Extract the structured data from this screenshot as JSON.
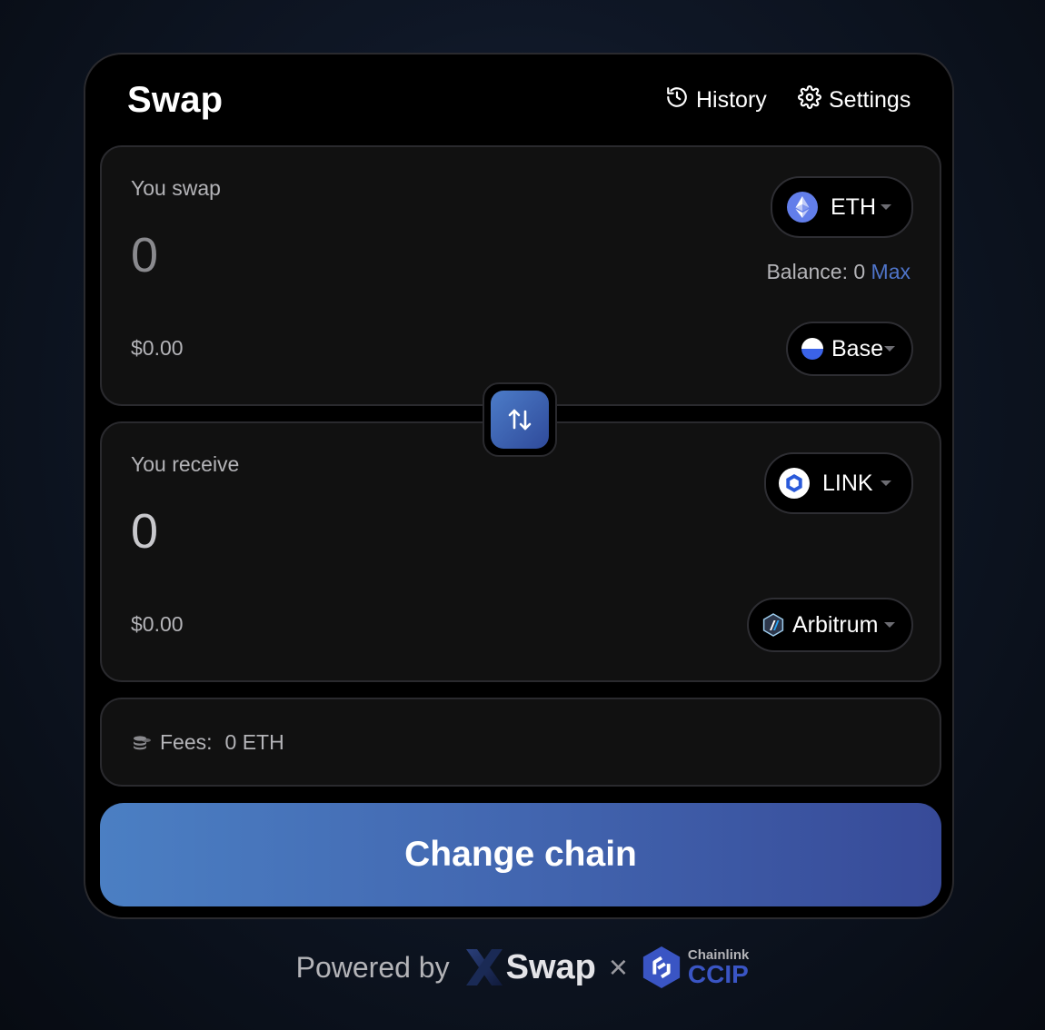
{
  "header": {
    "title": "Swap",
    "history_label": "History",
    "settings_label": "Settings"
  },
  "from": {
    "label": "You swap",
    "amount": "0",
    "usd": "$0.00",
    "token": "ETH",
    "balance_label": "Balance: 0",
    "max_label": "Max",
    "chain": "Base"
  },
  "to": {
    "label": "You receive",
    "amount": "0",
    "usd": "$0.00",
    "token": "LINK",
    "chain": "Arbitrum"
  },
  "fees": {
    "label": "Fees:",
    "value": "0 ETH"
  },
  "cta": {
    "label": "Change chain"
  },
  "footer": {
    "powered_by": "Powered by",
    "brand1": "Swap",
    "times": "×",
    "brand2_top": "Chainlink",
    "brand2_bottom": "CCIP"
  },
  "colors": {
    "accent": "#4f74c9",
    "cta_start": "#4b7fc3",
    "cta_end": "#374a98"
  },
  "icons": [
    "history-icon",
    "settings-icon",
    "eth-icon",
    "base-icon",
    "link-icon",
    "arbitrum-icon",
    "swap-direction-icon",
    "coins-icon",
    "xswap-logo",
    "chainlink-ccip-logo"
  ]
}
